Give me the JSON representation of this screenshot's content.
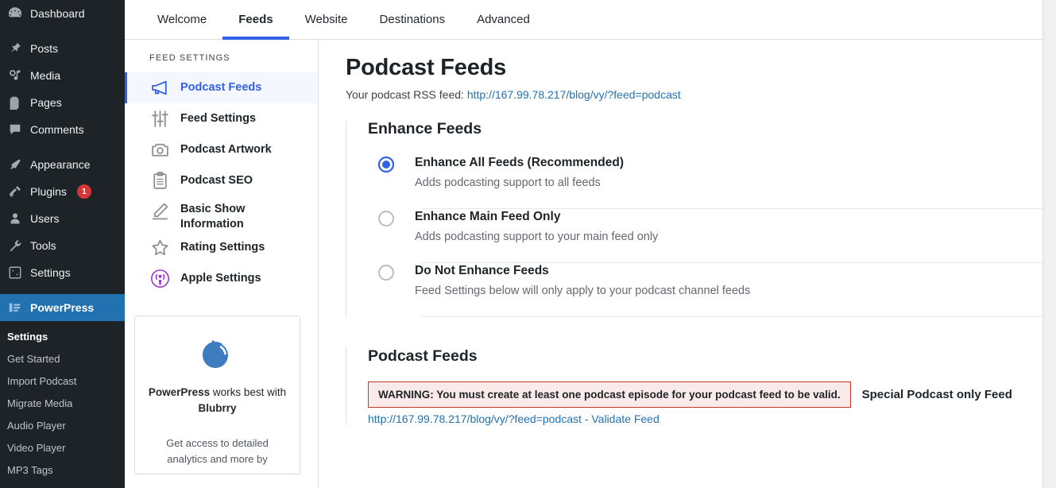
{
  "colors": {
    "wp_sidebar_bg": "#1d2327",
    "wp_current": "#2271b1",
    "accent_blue": "#3161e8",
    "link_blue": "#2271b1",
    "badge_red": "#d63638",
    "warning_border": "#c0392b",
    "warning_bg": "#fbeaea",
    "apple_purple": "#9933cc",
    "blubrry_blue": "#3c7cbf"
  },
  "wp_sidebar": {
    "items": [
      {
        "label": "Dashboard",
        "icon": "dashboard-icon",
        "badge": null,
        "current": false
      },
      {
        "label": "Posts",
        "icon": "pin-icon",
        "badge": null,
        "current": false
      },
      {
        "label": "Media",
        "icon": "media-icon",
        "badge": null,
        "current": false
      },
      {
        "label": "Pages",
        "icon": "pages-icon",
        "badge": null,
        "current": false
      },
      {
        "label": "Comments",
        "icon": "comments-icon",
        "badge": null,
        "current": false
      },
      {
        "label": "Appearance",
        "icon": "appearance-icon",
        "badge": null,
        "current": false
      },
      {
        "label": "Plugins",
        "icon": "plugins-icon",
        "badge": "1",
        "current": false
      },
      {
        "label": "Users",
        "icon": "users-icon",
        "badge": null,
        "current": false
      },
      {
        "label": "Tools",
        "icon": "tools-icon",
        "badge": null,
        "current": false
      },
      {
        "label": "Settings",
        "icon": "settings-icon",
        "badge": null,
        "current": false
      },
      {
        "label": "PowerPress",
        "icon": "powerpress-icon",
        "badge": null,
        "current": true
      }
    ],
    "submenu": [
      {
        "label": "Settings",
        "active": true
      },
      {
        "label": "Get Started",
        "active": false
      },
      {
        "label": "Import Podcast",
        "active": false
      },
      {
        "label": "Migrate Media",
        "active": false
      },
      {
        "label": "Audio Player",
        "active": false
      },
      {
        "label": "Video Player",
        "active": false
      },
      {
        "label": "MP3 Tags",
        "active": false
      }
    ]
  },
  "tabs": [
    {
      "label": "Welcome",
      "active": false
    },
    {
      "label": "Feeds",
      "active": true
    },
    {
      "label": "Website",
      "active": false
    },
    {
      "label": "Destinations",
      "active": false
    },
    {
      "label": "Advanced",
      "active": false
    }
  ],
  "feed_nav": {
    "title": "FEED SETTINGS",
    "items": [
      {
        "label": "Podcast Feeds",
        "icon": "megaphone-icon",
        "active": true,
        "wrap": false
      },
      {
        "label": "Feed Settings",
        "icon": "sliders-icon",
        "active": false,
        "wrap": false
      },
      {
        "label": "Podcast Artwork",
        "icon": "camera-icon",
        "active": false,
        "wrap": false
      },
      {
        "label": "Podcast SEO",
        "icon": "clipboard-icon",
        "active": false,
        "wrap": false
      },
      {
        "label": "Basic Show Information",
        "icon": "pencil-icon",
        "active": false,
        "wrap": true
      },
      {
        "label": "Rating Settings",
        "icon": "star-icon",
        "active": false,
        "wrap": false
      },
      {
        "label": "Apple Settings",
        "icon": "apple-podcasts-icon",
        "active": false,
        "wrap": false
      }
    ]
  },
  "promo": {
    "logo_icon": "blubrry-logo-icon",
    "headline_bold": "PowerPress",
    "headline_rest": " works best with",
    "brand": "Blubrry",
    "subtext": "Get access to detailed analytics and more by"
  },
  "main": {
    "title": "Podcast Feeds",
    "rss_label": "Your podcast RSS feed:",
    "rss_url": "http://167.99.78.217/blog/vy/?feed=podcast",
    "enhance": {
      "heading": "Enhance Feeds",
      "options": [
        {
          "title": "Enhance All Feeds (Recommended)",
          "desc": "Adds podcasting support to all feeds",
          "selected": true
        },
        {
          "title": "Enhance Main Feed Only",
          "desc": "Adds podcasting support to your main feed only",
          "selected": false
        },
        {
          "title": "Do Not Enhance Feeds",
          "desc": "Feed Settings below will only apply to your podcast channel feeds",
          "selected": false
        }
      ]
    },
    "feeds_section": {
      "heading": "Podcast Feeds",
      "warning": "WARNING: You must create at least one podcast episode for your podcast feed to be valid.",
      "special_label": "Special Podcast only Feed",
      "feed_url": "http://167.99.78.217/blog/vy/?feed=podcast",
      "validate_label": " - Validate Feed"
    }
  }
}
